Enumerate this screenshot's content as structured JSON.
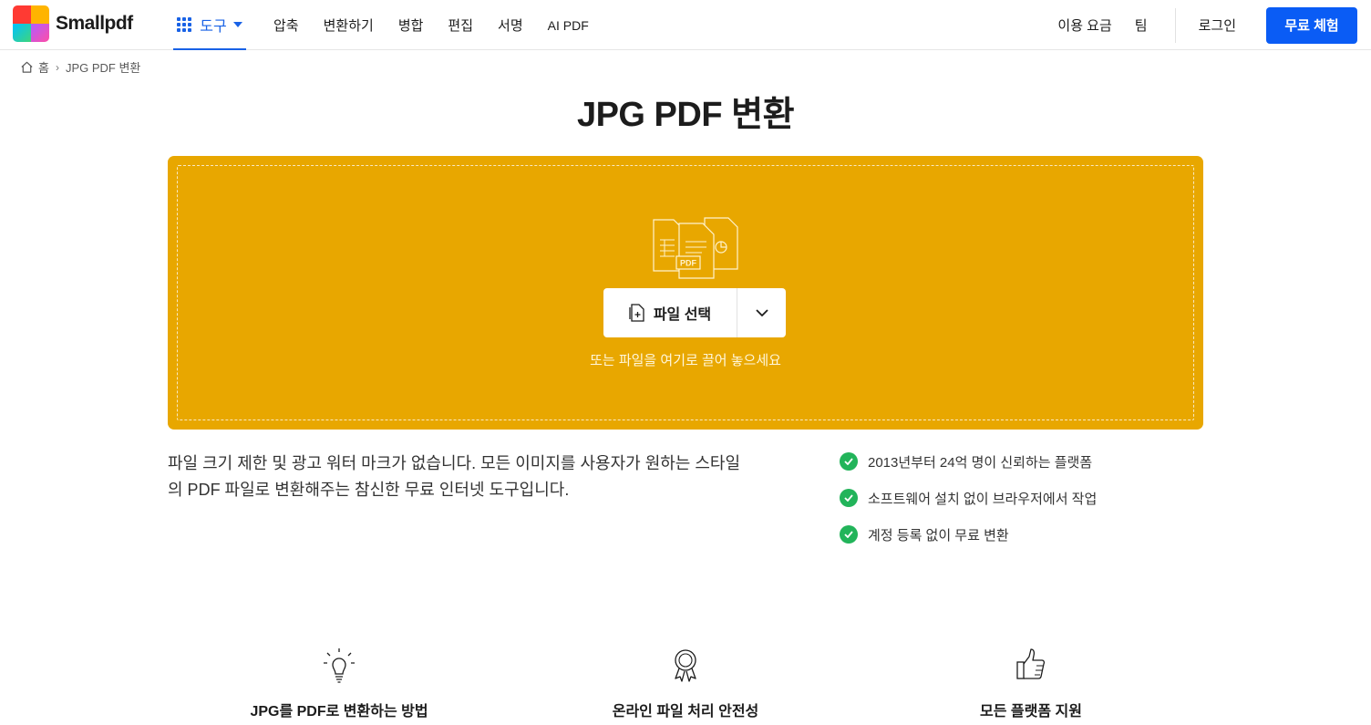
{
  "brand": {
    "name": "Smallpdf",
    "colors": [
      "#ff3a33",
      "#ffb400",
      "#3fd57a",
      "#1f6bff",
      "#b15cff",
      "#ff4ea6",
      "#00c2ff",
      "#4d7cff"
    ]
  },
  "nav": {
    "tools_label": "도구",
    "links": [
      "압축",
      "변환하기",
      "병합",
      "편집",
      "서명",
      "AI PDF"
    ],
    "pricing": "이용 요금",
    "team": "팀",
    "login": "로그인",
    "cta": "무료 체험",
    "accent": "#0a5cf5"
  },
  "breadcrumb": {
    "home": "홈",
    "current": "JPG PDF 변환"
  },
  "page": {
    "title": "JPG PDF 변환"
  },
  "dropzone": {
    "color": "#e8a700",
    "pdf_badge": "PDF",
    "choose_label": "파일 선택",
    "hint": "또는 파일을 여기로 끌어 놓으세요"
  },
  "description": "파일 크기 제한 및 광고 워터 마크가 없습니다. 모든 이미지를 사용자가 원하는 스타일의 PDF 파일로 변환해주는 참신한 무료 인터넷 도구입니다.",
  "features": [
    "2013년부터 24억 명이 신뢰하는 플랫폼",
    "소프트웨어 설치 없이 브라우저에서 작업",
    "계정 등록 없이 무료 변환"
  ],
  "info": [
    {
      "icon": "lightbulb-icon",
      "label": "JPG를 PDF로 변환하는 방법"
    },
    {
      "icon": "award-ribbon-icon",
      "label": "온라인 파일 처리 안전성"
    },
    {
      "icon": "thumbs-up-icon",
      "label": "모든 플랫폼 지원"
    }
  ]
}
